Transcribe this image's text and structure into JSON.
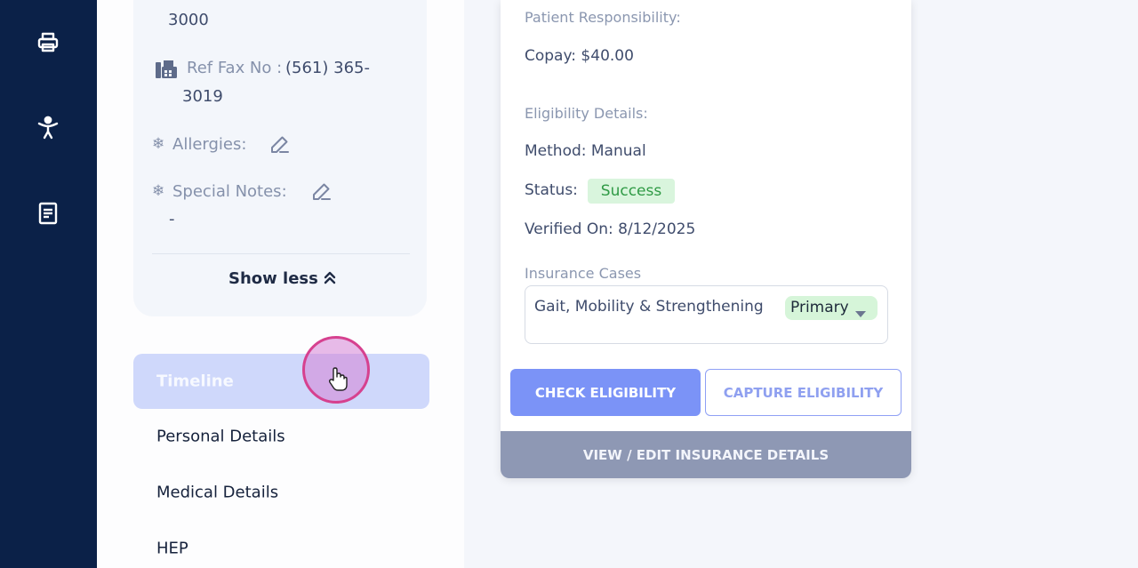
{
  "sidebar": {
    "icons": [
      "printer-icon",
      "person-stretch-icon",
      "document-icon"
    ]
  },
  "patient_card": {
    "phone_tail": "3000",
    "ref_fax_label": "Ref Fax No :",
    "ref_fax_value_line1": "(561) 365-",
    "ref_fax_value_line2": "3019",
    "allergies_label": "Allergies:",
    "special_notes_label": "Special Notes:",
    "special_notes_value": "-",
    "show_less_label": "Show less"
  },
  "left_nav": {
    "items": [
      {
        "label": "Timeline",
        "active": true
      },
      {
        "label": "Personal Details",
        "active": false
      },
      {
        "label": "Medical Details",
        "active": false
      },
      {
        "label": "HEP",
        "active": false
      }
    ]
  },
  "insurance": {
    "patient_responsibility_label": "Patient Responsibility:",
    "copay": "Copay: $40.00",
    "eligibility_details_label": "Eligibility Details:",
    "method": "Method: Manual",
    "status_label": "Status:",
    "status_value": "Success",
    "verified_on": "Verified On: 8/12/2025",
    "insurance_cases_label": "Insurance Cases",
    "case_name": "Gait, Mobility & Strengthening",
    "case_type": "Primary",
    "check_eligibility_label": "CHECK ELIGIBILITY",
    "capture_eligibility_label": "CAPTURE ELIGIBILITY",
    "view_edit_label": "VIEW / EDIT INSURANCE DETAILS"
  },
  "colors": {
    "rail": "#0b2148",
    "accent": "#7b93f7",
    "success": "#2f9a45",
    "active_nav": "#cfd8fb"
  }
}
